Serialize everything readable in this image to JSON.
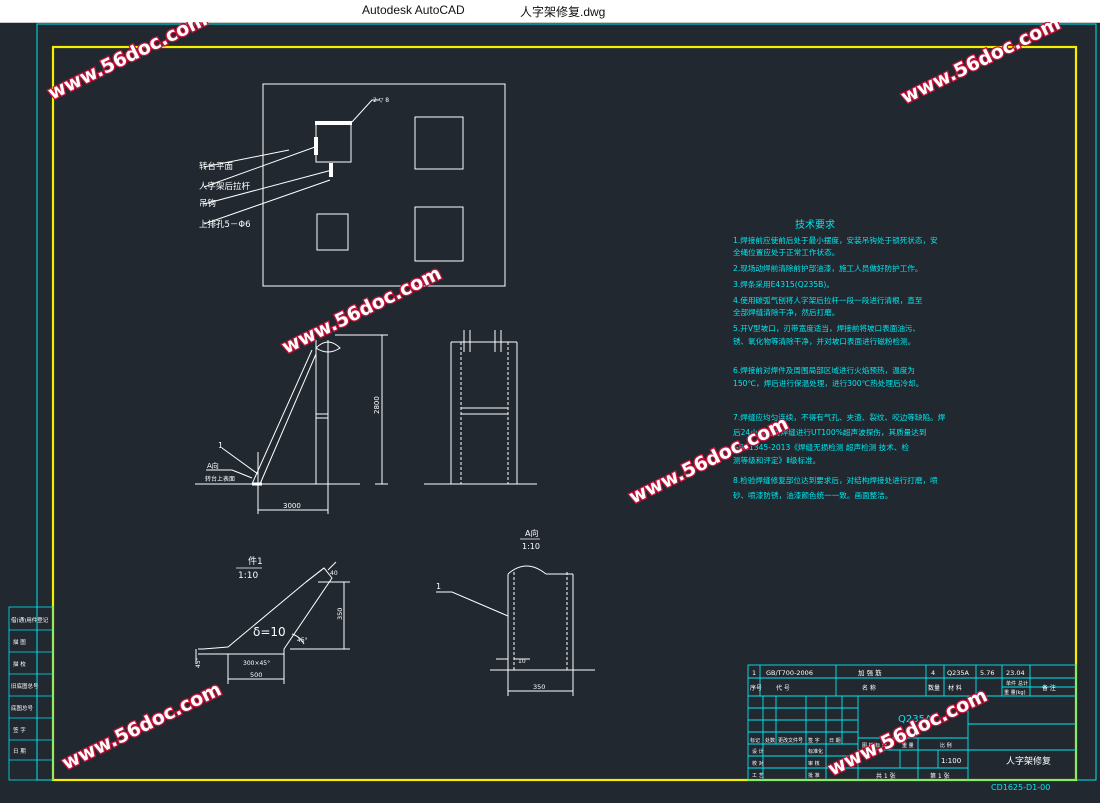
{
  "window": {
    "app_name": "Autodesk AutoCAD",
    "file_name": "人字架修复.dwg"
  },
  "colors": {
    "background": "#212830",
    "frame": "#f5ee00",
    "line": "#ffffff",
    "dim": "#e8e8e8",
    "annot": "#00e8f0",
    "watermark": "#c2143a"
  },
  "watermark": "www.56doc.com",
  "plan": {
    "labels": [
      "转台平面",
      "人字架后拉杆",
      "吊钩",
      "上排孔5－Φ6"
    ]
  },
  "elevation": {
    "height_dim": "2800",
    "span_dim": "3000",
    "ref_num": "1",
    "section_tag": "A向",
    "ground_label": "转台上表面"
  },
  "detail1": {
    "title": "件1",
    "scale": "1:10",
    "thickness": "δ=10",
    "dim_width": "500",
    "dim_height": "350",
    "dim_chamfer": "300×45°",
    "angle_a": "45°",
    "angle_b": "45°",
    "small_num": "40"
  },
  "detailA": {
    "title": "A向",
    "scale": "1:10",
    "ref_num": "1",
    "dim_gap": "10",
    "dim_width": "350"
  },
  "tech": {
    "title": "技术要求",
    "items": [
      "1.焊接前应使前后处于最小摆度，安装吊钩处于锁死状态，安",
      "   全绳位置应处于正常工作状态。",
      "2.现场动焊前清除前护部油漆，施工人员做好防护工作。",
      "3.焊条采用E4315(Q235B)。",
      "4.使用碳弧气刨将人字架后拉杆一段一段进行清根，直至",
      "   全部焊缝清除干净，然后打磨。",
      "5.开V型坡口，刃带宽度适当，焊接前将坡口表面油污、",
      "   锈、氧化物等清除干净，并对坡口表面进行磁粉检测。",
      "6.焊接前对焊件及周围局部区域进行火焰预热，温度为",
      "   150℃，焊后进行保温处理，进行300℃热处理后冷却。",
      "7.焊缝应均匀连续，不得有气孔、夹渣、裂纹、咬边等缺陷。焊",
      "   后24小时后对焊缝进行UT100%超声波探伤，其质量达到",
      "   GB11345-2013《焊缝无损检测 超声检测 技术、检",
      "   测等级和评定》Ⅱ级标准。",
      "8.检验焊缝修复部位达到要求后，对结构焊接处进行打磨，喷",
      "   砂、喷漆防锈，油漆颜色统一一致。画面整洁。"
    ]
  },
  "titleblock": {
    "bom_row": [
      "1",
      "GB/T700-2006",
      "加 强 筋",
      "4",
      "Q235A",
      "5.76",
      "23.04"
    ],
    "bom_headers": [
      "序号",
      "代    号",
      "名    称",
      "数量",
      "材    料",
      "单件",
      "总计",
      "备 注"
    ],
    "weight_label": "重 量(kg)",
    "material": "Q235A",
    "drawing_name": "人字架修复",
    "drawing_number": "CD1625-D1-00",
    "scale": "1:100",
    "sheets": "共 1 张",
    "sheet_no": "第 1 张",
    "left_cells": [
      "借(通)用件登记",
      "描    图",
      "描    校",
      "旧底图总号",
      "底图总号",
      "签    字",
      "日    期"
    ],
    "sig_labels": [
      "标记",
      "处数",
      "更改文件号",
      "签 字",
      "日 期",
      "设 计",
      "校 对",
      "工 艺",
      "标准化",
      "审 核",
      "批 准"
    ],
    "stage_labels": [
      "图 样 标 记",
      "重 量",
      "比 例"
    ]
  }
}
